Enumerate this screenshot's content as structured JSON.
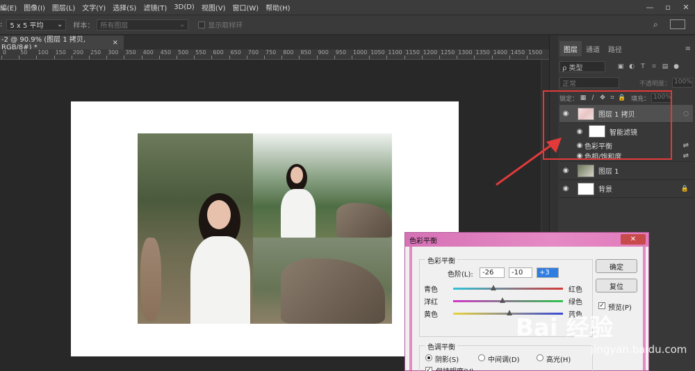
{
  "menubar": {
    "items": [
      "編(E)",
      "图像(I)",
      "图层(L)",
      "文字(Y)",
      "选择(S)",
      "滤镜(T)",
      "3D(D)",
      "视图(V)",
      "窗口(W)",
      "帮助(H)"
    ],
    "window_controls": [
      "—",
      "▫",
      "✕"
    ]
  },
  "options": {
    "sample_size": "5 x 5 平均",
    "sample_label": "样本：",
    "sample_value": "所有图层",
    "show_ring": "显示取样环"
  },
  "doc_tab": {
    "title": "-2 @ 90.9% (图层 1 拷贝, RGB/8#) *",
    "close": "×"
  },
  "ruler": {
    "ticks": [
      "0",
      "50",
      "100",
      "150",
      "200",
      "250",
      "300",
      "350",
      "400",
      "450",
      "500",
      "550",
      "600",
      "650",
      "700",
      "750",
      "800",
      "850",
      "900",
      "950",
      "1000",
      "1050",
      "1100",
      "1150",
      "1200",
      "1250",
      "1300",
      "1350",
      "1400",
      "1450",
      "1500"
    ]
  },
  "layers_panel": {
    "tabs": [
      "图层",
      "通道",
      "路径"
    ],
    "menu": "≡",
    "filter_kind": "ρ 类型",
    "blend_mode": "正常",
    "opacity_label": "不透明度：",
    "opacity_value": "100%",
    "lock_label": "锁定：",
    "fill_label": "填充：",
    "fill_value": "100%",
    "layers": [
      {
        "name": "图层 1 拷贝"
      },
      {
        "name": "图层 1"
      },
      {
        "name": "背景"
      }
    ],
    "smart_filter_label": "智能滤镜",
    "filters": [
      "色彩平衡",
      "色相/饱和度"
    ]
  },
  "dialog": {
    "title": "色彩平衡",
    "close": "✕",
    "group1_label": "色彩平衡",
    "levels_label": "色阶(L):",
    "level_values": [
      "-26",
      "-10",
      "+3"
    ],
    "left_labels": [
      "青色",
      "洋红",
      "黄色"
    ],
    "right_labels": [
      "红色",
      "绿色",
      "蓝色"
    ],
    "slider_levels": [
      -26,
      -10,
      3
    ],
    "ok": "确定",
    "reset": "复位",
    "preview": "预览(P)",
    "group2_label": "色调平衡",
    "tones": [
      "阴影(S)",
      "中间调(D)",
      "高光(H)"
    ],
    "preserve": "保持明度(V)"
  },
  "watermark": {
    "main": "Bai 经验",
    "sub": "jingyan.baidu.com"
  },
  "colors": {
    "highlight": "#e23a3a",
    "dialog_accent": "#e27cbd"
  }
}
